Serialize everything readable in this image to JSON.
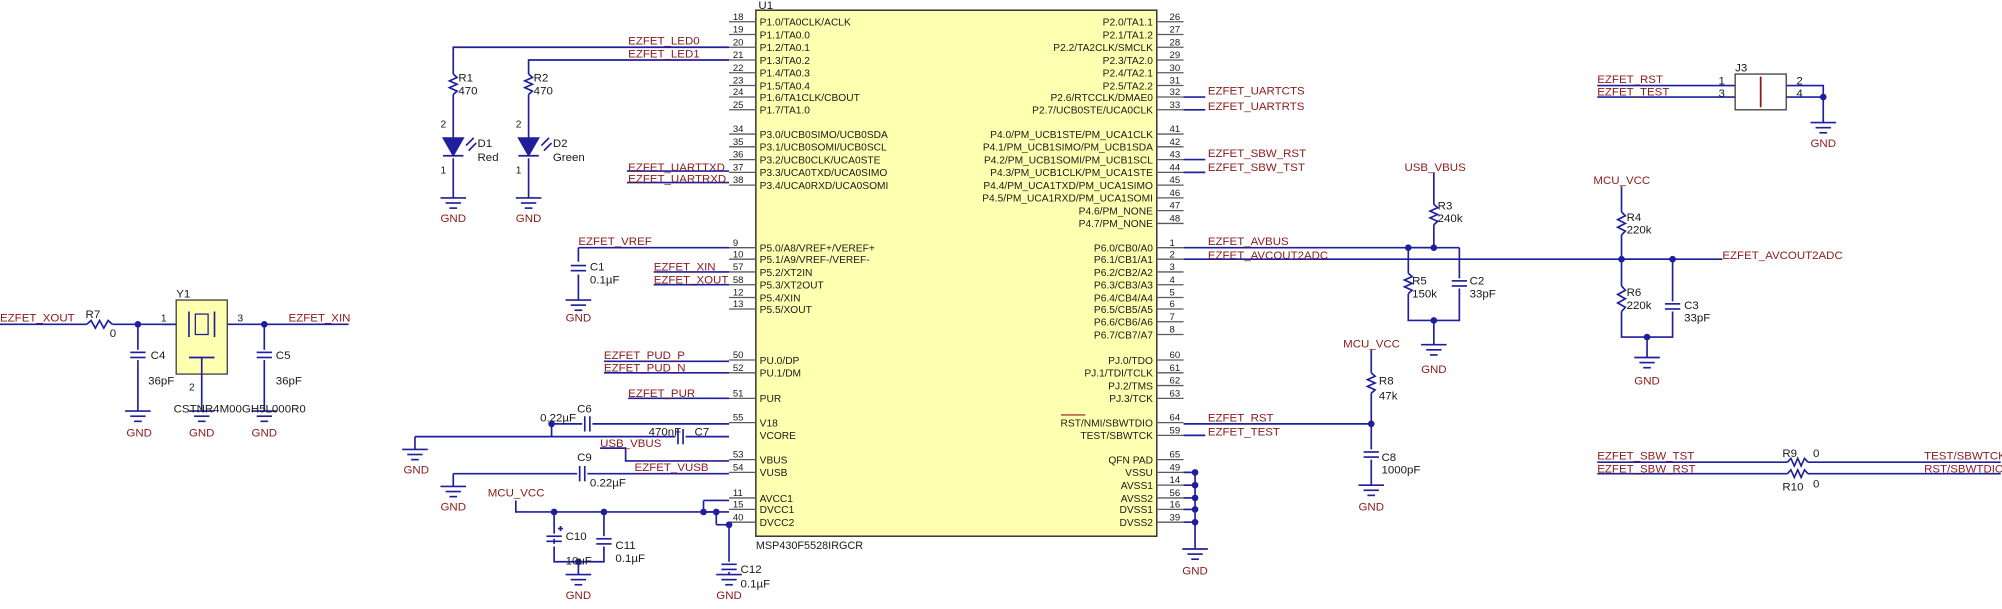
{
  "ic": {
    "ref": "U1",
    "part": "MSP430F5528IRGCR",
    "left": [
      {
        "n": "18",
        "name": "P1.0/TA0CLK/ACLK"
      },
      {
        "n": "19",
        "name": "P1.1/TA0.0"
      },
      {
        "n": "20",
        "name": "P1.2/TA0.1"
      },
      {
        "n": "21",
        "name": "P1.3/TA0.2"
      },
      {
        "n": "22",
        "name": "P1.4/TA0.3"
      },
      {
        "n": "23",
        "name": "P1.5/TA0.4"
      },
      {
        "n": "24",
        "name": "P1.6/TA1CLK/CBOUT"
      },
      {
        "n": "25",
        "name": "P1.7/TA1.0"
      },
      {
        "n": "34",
        "name": "P3.0/UCB0SIMO/UCB0SDA"
      },
      {
        "n": "35",
        "name": "P3.1/UCB0SOMI/UCB0SCL"
      },
      {
        "n": "36",
        "name": "P3.2/UCB0CLK/UCA0STE"
      },
      {
        "n": "37",
        "name": "P3.3/UCA0TXD/UCA0SIMO"
      },
      {
        "n": "38",
        "name": "P3.4/UCA0RXD/UCA0SOMI"
      },
      {
        "n": "9",
        "name": "P5.0/A8/VREF+/VEREF+"
      },
      {
        "n": "10",
        "name": "P5.1/A9/VREF-/VEREF-"
      },
      {
        "n": "57",
        "name": "P5.2/XT2IN"
      },
      {
        "n": "58",
        "name": "P5.3/XT2OUT"
      },
      {
        "n": "12",
        "name": "P5.4/XIN"
      },
      {
        "n": "13",
        "name": "P5.5/XOUT"
      },
      {
        "n": "50",
        "name": "PU.0/DP"
      },
      {
        "n": "52",
        "name": "PU.1/DM"
      },
      {
        "n": "51",
        "name": "PUR"
      },
      {
        "n": "55",
        "name": "V18"
      },
      {
        "n": "",
        "name": "VCORE"
      },
      {
        "n": "53",
        "name": "VBUS"
      },
      {
        "n": "54",
        "name": "VUSB"
      },
      {
        "n": "11",
        "name": "AVCC1"
      },
      {
        "n": "15",
        "name": "DVCC1"
      },
      {
        "n": "40",
        "name": "DVCC2"
      }
    ],
    "right": [
      {
        "n": "26",
        "name": "P2.0/TA1.1"
      },
      {
        "n": "27",
        "name": "P2.1/TA1.2"
      },
      {
        "n": "28",
        "name": "P2.2/TA2CLK/SMCLK"
      },
      {
        "n": "29",
        "name": "P2.3/TA2.0"
      },
      {
        "n": "30",
        "name": "P2.4/TA2.1"
      },
      {
        "n": "31",
        "name": "P2.5/TA2.2"
      },
      {
        "n": "32",
        "name": "P2.6/RTCCLK/DMAE0"
      },
      {
        "n": "33",
        "name": "P2.7/UCB0STE/UCA0CLK"
      },
      {
        "n": "41",
        "name": "P4.0/PM_UCB1STE/PM_UCA1CLK"
      },
      {
        "n": "42",
        "name": "P4.1/PM_UCB1SIMO/PM_UCB1SDA"
      },
      {
        "n": "43",
        "name": "P4.2/PM_UCB1SOMI/PM_UCB1SCL"
      },
      {
        "n": "44",
        "name": "P4.3/PM_UCB1CLK/PM_UCA1STE"
      },
      {
        "n": "45",
        "name": "P4.4/PM_UCA1TXD/PM_UCA1SIMO"
      },
      {
        "n": "46",
        "name": "P4.5/PM_UCA1RXD/PM_UCA1SOMI"
      },
      {
        "n": "47",
        "name": "P4.6/PM_NONE"
      },
      {
        "n": "48",
        "name": "P4.7/PM_NONE"
      },
      {
        "n": "1",
        "name": "P6.0/CB0/A0"
      },
      {
        "n": "2",
        "name": "P6.1/CB1/A1"
      },
      {
        "n": "3",
        "name": "P6.2/CB2/A2"
      },
      {
        "n": "4",
        "name": "P6.3/CB3/A3"
      },
      {
        "n": "5",
        "name": "P6.4/CB4/A4"
      },
      {
        "n": "6",
        "name": "P6.5/CB5/A5"
      },
      {
        "n": "7",
        "name": "P6.6/CB6/A6"
      },
      {
        "n": "8",
        "name": "P6.7/CB7/A7"
      },
      {
        "n": "60",
        "name": "PJ.0/TDO"
      },
      {
        "n": "61",
        "name": "PJ.1/TDI/TCLK"
      },
      {
        "n": "62",
        "name": "PJ.2/TMS"
      },
      {
        "n": "63",
        "name": "PJ.3/TCK"
      },
      {
        "n": "64",
        "name": "RST/NMI/SBWTDIO"
      },
      {
        "n": "59",
        "name": "TEST/SBWTCK"
      },
      {
        "n": "65",
        "name": "QFN PAD"
      },
      {
        "n": "49",
        "name": "VSSU"
      },
      {
        "n": "14",
        "name": "AVSS1"
      },
      {
        "n": "56",
        "name": "AVSS2"
      },
      {
        "n": "16",
        "name": "DVSS1"
      },
      {
        "n": "39",
        "name": "DVSS2"
      }
    ]
  },
  "nets": {
    "led0": "EZFET_LED0",
    "led1": "EZFET_LED1",
    "uarttxd": "EZFET_UARTTXD",
    "uartrxd": "EZFET_UARTRXD",
    "vref": "EZFET_VREF",
    "xin": "EZFET_XIN",
    "xout": "EZFET_XOUT",
    "pud_p": "EZFET_PUD_P",
    "pud_n": "EZFET_PUD_N",
    "pur": "EZFET_PUR",
    "usb_vbus": "USB_VBUS",
    "vusb": "EZFET_VUSB",
    "mcu_vcc": "MCU_VCC",
    "uartcts": "EZFET_UARTCTS",
    "uartrts": "EZFET_UARTRTS",
    "sbw_rst": "EZFET_SBW_RST",
    "sbw_tst": "EZFET_SBW_TST",
    "avbus": "EZFET_AVBUS",
    "avcout2adc": "EZFET_AVCOUT2ADC",
    "rst": "EZFET_RST",
    "test": "EZFET_TEST",
    "test_sbwtck": "TEST/SBWTCK",
    "rst_sbwtdio": "RST/SBWTDIO",
    "gnd": "GND"
  },
  "components": {
    "r1": {
      "ref": "R1",
      "value": "470"
    },
    "r2": {
      "ref": "R2",
      "value": "470"
    },
    "d1": {
      "ref": "D1",
      "value": "Red"
    },
    "d2": {
      "ref": "D2",
      "value": "Green"
    },
    "c1": {
      "ref": "C1",
      "value": "0.1µF"
    },
    "r7": {
      "ref": "R7",
      "value": "0"
    },
    "c4": {
      "ref": "C4",
      "value": "36pF"
    },
    "c5": {
      "ref": "C5",
      "value": "36pF"
    },
    "y1": {
      "ref": "Y1",
      "value": "CSTNR4M00GH5L000R0"
    },
    "c6": {
      "ref": "C6",
      "value": "0.22µF"
    },
    "c7": {
      "ref": "C7",
      "value": "470nF"
    },
    "c9": {
      "ref": "C9",
      "value": "0.22µF"
    },
    "c10": {
      "ref": "C10",
      "value": "10uF"
    },
    "c11": {
      "ref": "C11",
      "value": "0.1µF"
    },
    "c12": {
      "ref": "C12",
      "value": "0.1µF"
    },
    "r3": {
      "ref": "R3",
      "value": "240k"
    },
    "r5": {
      "ref": "R5",
      "value": "150k"
    },
    "c2": {
      "ref": "C2",
      "value": "33pF"
    },
    "r8": {
      "ref": "R8",
      "value": "47k"
    },
    "c8": {
      "ref": "C8",
      "value": "1000pF"
    },
    "r4": {
      "ref": "R4",
      "value": "220k"
    },
    "r6": {
      "ref": "R6",
      "value": "220k"
    },
    "c3": {
      "ref": "C3",
      "value": "33pF"
    },
    "j3": {
      "ref": "J3",
      "pins": [
        "1",
        "2",
        "3",
        "4"
      ]
    },
    "r9": {
      "ref": "R9",
      "value": "0"
    },
    "r10": {
      "ref": "R10",
      "value": "0"
    }
  },
  "pin_numbers": {
    "d_anode": "2",
    "d_cathode": "1",
    "y1_p1": "1",
    "y1_p2": "2",
    "y1_p3": "3"
  },
  "colors": {
    "wire": "#1f1f9e",
    "net_label": "#8b1a1a",
    "ic_fill": "#ffffb0"
  }
}
